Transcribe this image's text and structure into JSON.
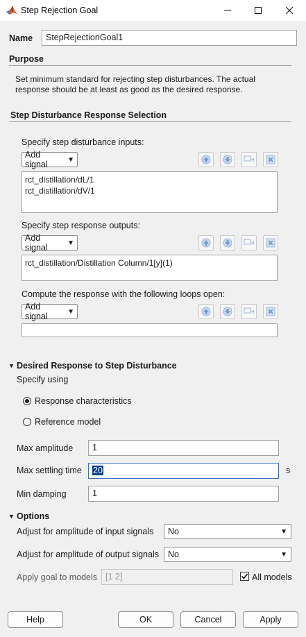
{
  "window": {
    "title": "Step Rejection Goal"
  },
  "name": {
    "label": "Name",
    "value": "StepRejectionGoal1"
  },
  "purpose": {
    "heading": "Purpose",
    "text_line1": "Set minimum standard for rejecting step disturbances. The actual",
    "text_line2": "response should be at least as good as the desired response."
  },
  "selection": {
    "heading": "Step Disturbance Response Selection",
    "inputs": {
      "label": "Specify step disturbance inputs:",
      "add_label": "Add signal",
      "items": [
        "rct_distillation/dL/1",
        "rct_distillation/dV/1"
      ]
    },
    "outputs": {
      "label": "Specify step response outputs:",
      "add_label": "Add signal",
      "items": [
        "rct_distillation/Distillation Column/1[y](1)"
      ]
    },
    "loops": {
      "label": "Compute the response with the following loops open:",
      "add_label": "Add signal"
    }
  },
  "desired": {
    "heading": "Desired Response to Step Disturbance",
    "specify_label": "Specify using",
    "radio1": "Response characteristics",
    "radio2": "Reference model",
    "selected": "Response characteristics",
    "max_amp_label": "Max amplitude",
    "max_amp_value": "1",
    "max_settle_label": "Max settling time",
    "max_settle_value": "20",
    "settle_unit": "s",
    "min_damp_label": "Min damping",
    "min_damp_value": "1"
  },
  "options": {
    "heading": "Options",
    "input_amp_label": "Adjust for amplitude of input signals",
    "input_amp_value": "No",
    "output_amp_label": "Adjust for amplitude of output signals",
    "output_amp_value": "No",
    "models_label": "Apply goal to models",
    "models_value": "[1 2]",
    "all_models_label": "All models",
    "all_models_checked": true
  },
  "buttons": {
    "help": "Help",
    "ok": "OK",
    "cancel": "Cancel",
    "apply": "Apply"
  }
}
